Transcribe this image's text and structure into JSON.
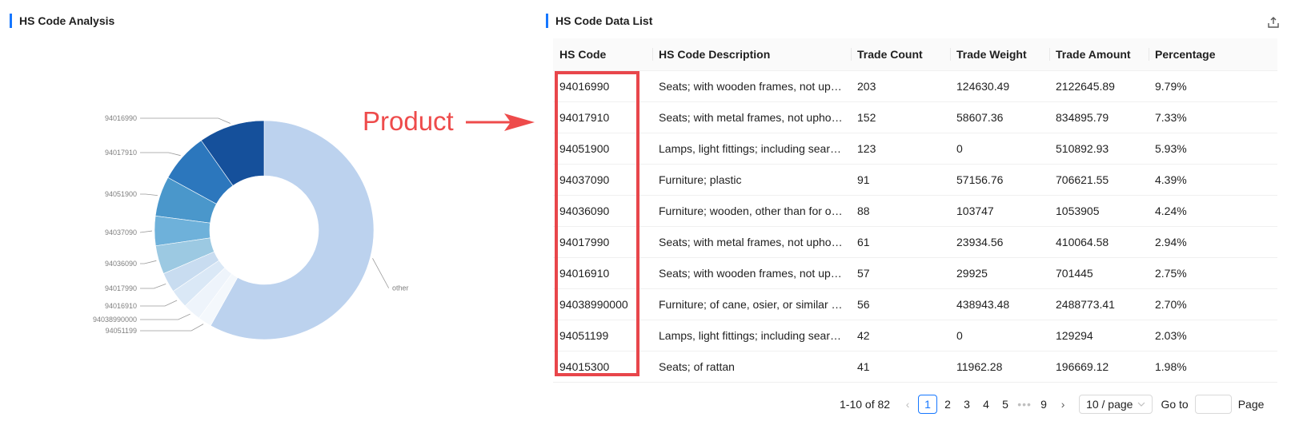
{
  "left_panel": {
    "title": "HS Code Analysis"
  },
  "right_panel": {
    "title": "HS Code Data List",
    "export_icon": "export-icon"
  },
  "annotation": {
    "text": "Product",
    "color": "#ee4b4b",
    "box_color": "#e8464b"
  },
  "table": {
    "columns": [
      "HS Code",
      "HS Code Description",
      "Trade Count",
      "Trade Weight",
      "Trade Amount",
      "Percentage"
    ],
    "rows": [
      [
        "94016990",
        "Seats; with wooden frames, not upho...",
        "203",
        "124630.49",
        "2122645.89",
        "9.79%"
      ],
      [
        "94017910",
        "Seats; with metal frames, not upholst...",
        "152",
        "58607.36",
        "834895.79",
        "7.33%"
      ],
      [
        "94051900",
        "Lamps, light fittings; including search...",
        "123",
        "0",
        "510892.93",
        "5.93%"
      ],
      [
        "94037090",
        "Furniture; plastic",
        "91",
        "57156.76",
        "706621.55",
        "4.39%"
      ],
      [
        "94036090",
        "Furniture; wooden, other than for off...",
        "88",
        "103747",
        "1053905",
        "4.24%"
      ],
      [
        "94017990",
        "Seats; with metal frames, not upholst...",
        "61",
        "23934.56",
        "410064.58",
        "2.94%"
      ],
      [
        "94016910",
        "Seats; with wooden frames, not upho...",
        "57",
        "29925",
        "701445",
        "2.75%"
      ],
      [
        "94038990000",
        "Furniture; of cane, osier, or similar m...",
        "56",
        "438943.48",
        "2488773.41",
        "2.70%"
      ],
      [
        "94051199",
        "Lamps, light fittings; including search...",
        "42",
        "0",
        "129294",
        "2.03%"
      ],
      [
        "94015300",
        "Seats; of rattan",
        "41",
        "11962.28",
        "196669.12",
        "1.98%"
      ]
    ]
  },
  "pagination": {
    "range_text": "1-10 of 82",
    "pages": [
      "1",
      "2",
      "3",
      "4",
      "5",
      "•••",
      "9"
    ],
    "current_page": "1",
    "prev_icon": "‹",
    "next_icon": "›",
    "page_size": "10 / page",
    "goto_label": "Go to",
    "page_label": "Page"
  },
  "chart_data": {
    "type": "pie",
    "donut": true,
    "labels": [
      "other",
      "94016990",
      "94017910",
      "94051900",
      "94037090",
      "94036090",
      "94017990",
      "94016910",
      "94038990000",
      "94051199"
    ],
    "values": [
      58.4,
      9.79,
      7.33,
      5.93,
      4.39,
      4.24,
      2.94,
      2.75,
      2.7,
      2.03
    ],
    "colors": [
      "#bcd2ee",
      "#15509b",
      "#2c77bd",
      "#4a97cb",
      "#6eb1da",
      "#9cc9e2",
      "#c8dcf0",
      "#dae8f6",
      "#eef4fb",
      "#f4f8fc"
    ]
  }
}
